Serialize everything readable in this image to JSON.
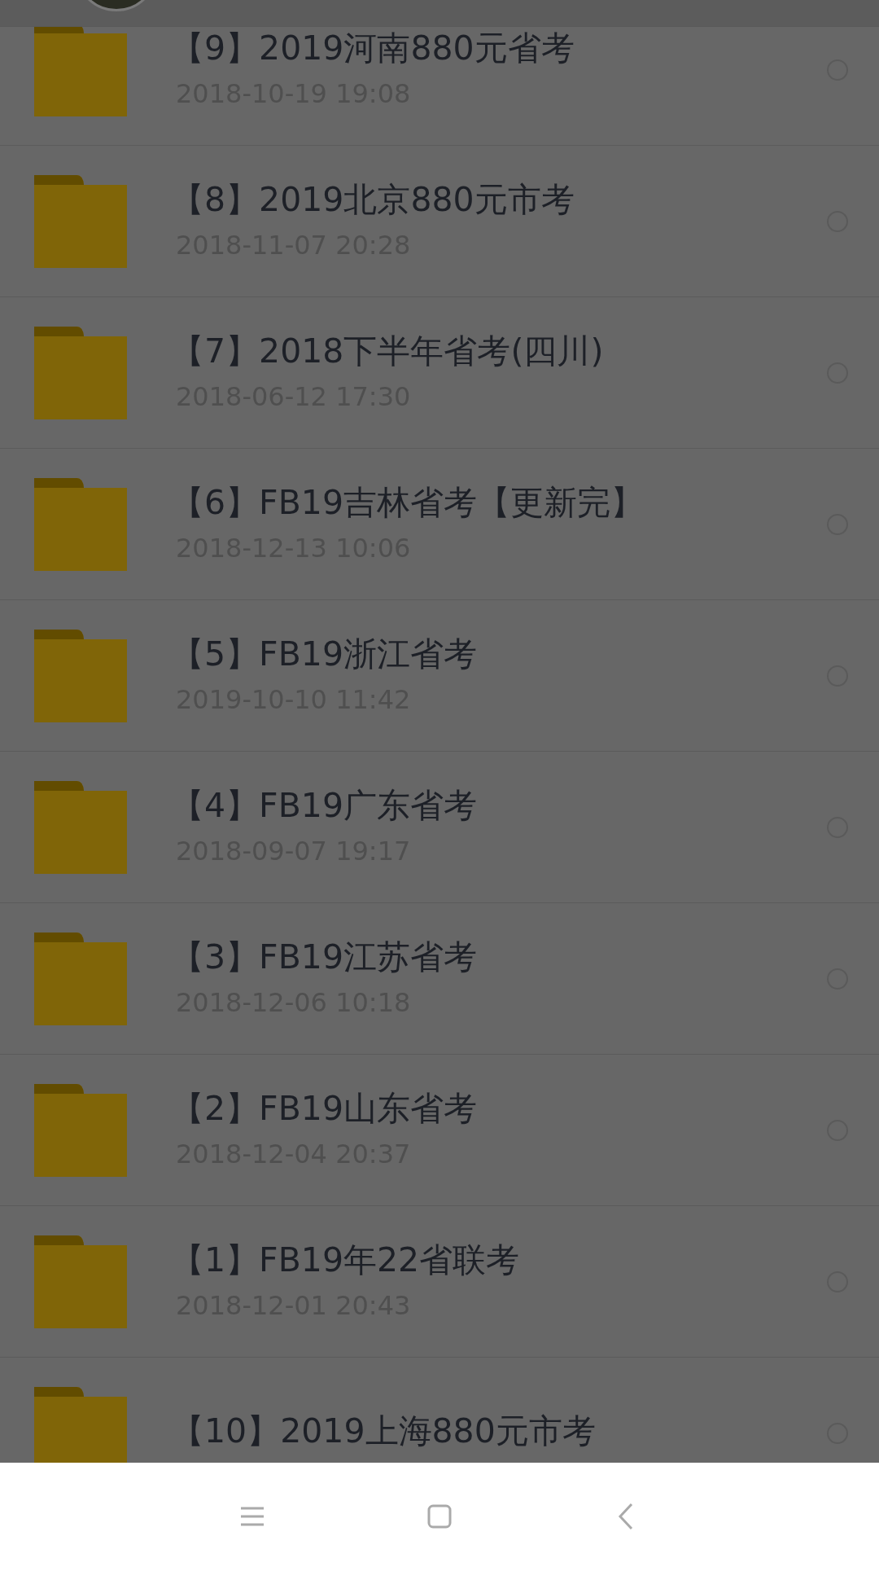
{
  "folders": [
    {
      "title": "【9】2019河南880元省考",
      "date": "2018-10-19  19:08",
      "selected": false
    },
    {
      "title": "【8】2019北京880元市考",
      "date": "2018-11-07  20:28",
      "selected": false
    },
    {
      "title": "【7】2018下半年省考(四川)",
      "date": "2018-06-12  17:30",
      "selected": false
    },
    {
      "title": "【6】FB19吉林省考【更新完】",
      "date": "2018-12-13  10:06",
      "selected": false
    },
    {
      "title": "【5】FB19浙江省考",
      "date": "2019-10-10  11:42",
      "selected": false
    },
    {
      "title": "【4】FB19广东省考",
      "date": "2018-09-07  19:17",
      "selected": false
    },
    {
      "title": "【3】FB19江苏省考",
      "date": "2018-12-06  10:18",
      "selected": false
    },
    {
      "title": "【2】FB19山东省考",
      "date": "2018-12-04  20:37",
      "selected": false
    },
    {
      "title": "【1】FB19年22省联考",
      "date": "2018-12-01  20:43",
      "selected": false
    },
    {
      "title": "【10】2019上海880元市考",
      "selected": false
    }
  ]
}
